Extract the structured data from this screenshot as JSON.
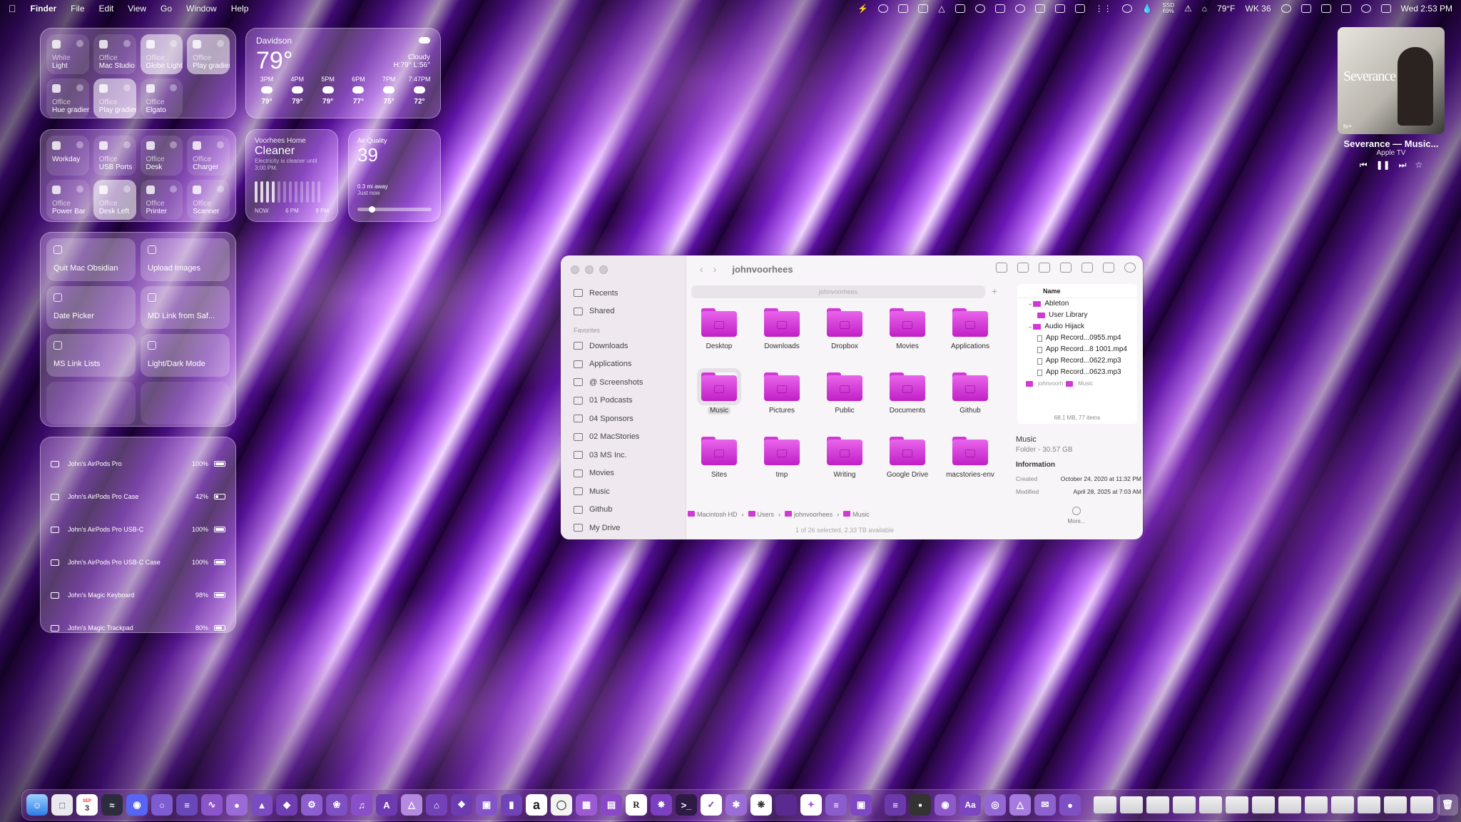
{
  "menubar": {
    "app": "Finder",
    "menus": [
      "File",
      "Edit",
      "View",
      "Go",
      "Window",
      "Help"
    ],
    "ssd_label": "SSD",
    "ssd_value": "69%",
    "weather": "79°F",
    "week": "WK 36",
    "datetime": "Wed 2:53 PM"
  },
  "home_tiles": [
    {
      "l1": "White",
      "l2": "Light",
      "on": false
    },
    {
      "l1": "Office",
      "l2": "Mac Studio",
      "on": false
    },
    {
      "l1": "Office",
      "l2": "Globe Light",
      "on": true
    },
    {
      "l1": "Office",
      "l2": "Play gradient",
      "on": true
    },
    {
      "l1": "Office",
      "l2": "Hue gradient",
      "on": false
    },
    {
      "l1": "Office",
      "l2": "Play gradient",
      "on": true
    },
    {
      "l1": "Office",
      "l2": "Elgato",
      "on": false
    }
  ],
  "home_tiles2": [
    {
      "l1": "",
      "l2": "Workday",
      "on": false
    },
    {
      "l1": "Office",
      "l2": "USB Ports",
      "on": false
    },
    {
      "l1": "Office",
      "l2": "Desk",
      "on": false
    },
    {
      "l1": "Office",
      "l2": "Charger",
      "on": false
    },
    {
      "l1": "Office",
      "l2": "Power Bar",
      "on": false
    },
    {
      "l1": "Office",
      "l2": "Desk Left",
      "on": true
    },
    {
      "l1": "Office",
      "l2": "Printer",
      "on": false
    },
    {
      "l1": "Office",
      "l2": "Scanner",
      "on": false
    }
  ],
  "weather": {
    "location": "Davidson",
    "temp": "79°",
    "condition": "Cloudy",
    "hilo": "H:79° L:56°",
    "hours": [
      {
        "time": "3PM",
        "temp": "79°"
      },
      {
        "time": "4PM",
        "temp": "79°"
      },
      {
        "time": "5PM",
        "temp": "79°"
      },
      {
        "time": "6PM",
        "temp": "77°"
      },
      {
        "time": "7PM",
        "temp": "75°"
      },
      {
        "time": "7:47PM",
        "temp": "72°"
      }
    ]
  },
  "home_energy": {
    "title": "Voorhees Home",
    "status": "Cleaner",
    "note": "Electricity is cleaner until 3:00 PM.",
    "t_now": "NOW",
    "t_6": "6 PM",
    "t_9": "9 PM"
  },
  "air_quality": {
    "title": "Air Quality",
    "value": "39",
    "distance": "0.3 mi away",
    "updated": "Just now",
    "level": 0.15
  },
  "shortcuts": [
    {
      "label": "Quit Mac Obsidian"
    },
    {
      "label": "Upload Images"
    },
    {
      "label": "Date Picker"
    },
    {
      "label": "MD Link from Saf..."
    },
    {
      "label": "MS Link Lists"
    },
    {
      "label": "Light/Dark Mode"
    },
    {
      "label": ""
    },
    {
      "label": ""
    }
  ],
  "batteries": [
    {
      "name": "John's AirPods Pro",
      "pct": "100%",
      "level": 1.0
    },
    {
      "name": "John's AirPods Pro Case",
      "pct": "42%",
      "level": 0.42
    },
    {
      "name": "John's AirPods Pro USB-C",
      "pct": "100%",
      "level": 1.0
    },
    {
      "name": "John's AirPods Pro USB-C Case",
      "pct": "100%",
      "level": 1.0
    },
    {
      "name": "John's Magic Keyboard",
      "pct": "98%",
      "level": 0.98
    },
    {
      "name": "John's Magic Trackpad",
      "pct": "80%",
      "level": 0.8
    }
  ],
  "now_playing": {
    "art_title": "Severance",
    "art_badge": "tv+",
    "title": "Severance — Music...",
    "source": "Apple TV"
  },
  "finder": {
    "title": "johnvoorhees",
    "path_field": "johnvoorhees",
    "sidebar_top": [
      "Recents",
      "Shared"
    ],
    "favorites_heading": "Favorites",
    "favorites": [
      "Downloads",
      "Applications",
      "@ Screenshots",
      "01 Podcasts",
      "04 Sponsors",
      "02 MacStories",
      "03 MS Inc.",
      "Movies",
      "Music",
      "Github",
      "My Drive"
    ],
    "items": [
      "Desktop",
      "Downloads",
      "Dropbox",
      "Movies",
      "Applications",
      "Music",
      "Pictures",
      "Public",
      "Documents",
      "Github",
      "Sites",
      "tmp",
      "Writing",
      "Google Drive",
      "macstories-env"
    ],
    "selected": "Music",
    "path": [
      "Macintosh HD",
      "Users",
      "johnvoorhees",
      "Music"
    ],
    "status": "1 of 26 selected, 2.33 TB available",
    "column": {
      "header": "Name",
      "rows": [
        {
          "label": "Ableton",
          "kind": "folder",
          "indent": 0
        },
        {
          "label": "User Library",
          "kind": "folder",
          "indent": 1
        },
        {
          "label": "Audio Hijack",
          "kind": "folder",
          "indent": 0
        },
        {
          "label": "App Record...0955.mp4",
          "kind": "file",
          "indent": 1
        },
        {
          "label": "App Record...8 1001.mp4",
          "kind": "file",
          "indent": 1
        },
        {
          "label": "App Record...0622.mp3",
          "kind": "file",
          "indent": 1
        },
        {
          "label": "App Record...0623.mp3",
          "kind": "file",
          "indent": 1
        }
      ],
      "crumb_user": "johnvoorh",
      "crumb_folder": "Music",
      "footer": "68.1 MB, 77 items"
    },
    "preview": {
      "name": "Music",
      "kind": "Folder - 30.57 GB",
      "info_heading": "Information",
      "created_label": "Created",
      "created": "October 24, 2020 at 11:32 PM",
      "modified_label": "Modified",
      "modified": "April 28, 2025 at 7:03 AM",
      "more": "More..."
    }
  },
  "dock": {
    "calendar_month": "SEP",
    "calendar_day": "3",
    "amazon": "a",
    "reeder": "R",
    "dictionary": "Aa"
  },
  "colors": {
    "folder": "#d238d6",
    "wallpaper": "#3b0a6a"
  }
}
